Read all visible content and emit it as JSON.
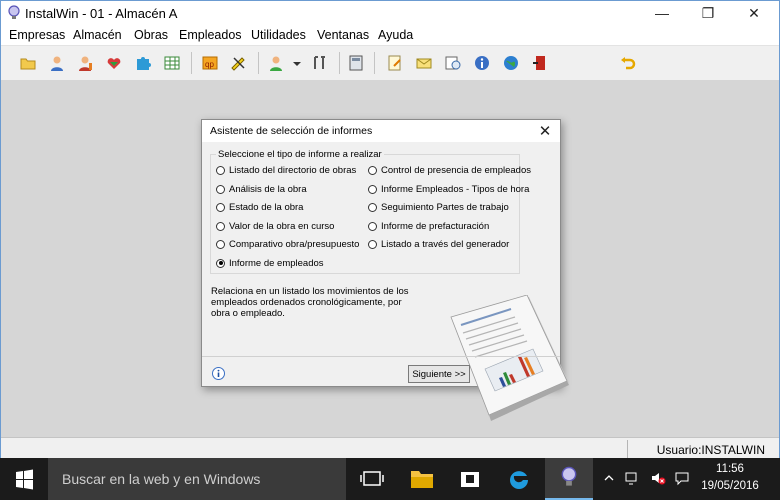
{
  "window": {
    "title": "InstalWin - 01 - Almacén A",
    "minimize": "—",
    "maximize": "❐",
    "close": "✕"
  },
  "menu": [
    "Empresas",
    "Almacén",
    "Obras",
    "Empleados",
    "Utilidades",
    "Ventanas",
    "Ayuda"
  ],
  "toolbar_icons": [
    "open-folder-icon",
    "user-icon",
    "user-edit-icon",
    "hearts-icon",
    "puzzle-icon",
    "table-icon",
    "qp-report-icon",
    "pencil-ruler-icon",
    "green-user-icon",
    "dropdown-arrow-icon",
    "tools-icon",
    "calculator-icon",
    "notepad-edit-icon",
    "envelope-icon",
    "clock-calendar-icon",
    "info-icon",
    "globe-icon",
    "exit-door-icon",
    "undo-arrow-icon"
  ],
  "statusbar": {
    "user": "Usuario:INSTALWIN"
  },
  "dialog": {
    "title": "Asistente de selección de informes",
    "close": "✕",
    "group_label": "Seleccione el tipo de informe a realizar",
    "options_left": [
      {
        "label": "Listado del directorio de obras",
        "selected": false
      },
      {
        "label": "Análisis de la obra",
        "selected": false
      },
      {
        "label": "Estado de la obra",
        "selected": false
      },
      {
        "label": "Valor de la obra en curso",
        "selected": false
      },
      {
        "label": "Comparativo obra/presupuesto",
        "selected": false
      },
      {
        "label": "Informe de empleados",
        "selected": true
      }
    ],
    "options_right": [
      {
        "label": "Control de presencia de empleados",
        "selected": false
      },
      {
        "label": "Informe Empleados - Tipos de hora",
        "selected": false
      },
      {
        "label": "Seguimiento Partes de trabajo",
        "selected": false
      },
      {
        "label": "Informe de prefacturación",
        "selected": false
      },
      {
        "label": "Listado a través del generador",
        "selected": false
      }
    ],
    "description": "Relaciona en un listado los movimientos de los empleados ordenados cronológicamente, por obra o empleado.",
    "next_button": "Siguiente >>"
  },
  "taskbar": {
    "search_placeholder": "Buscar en la web y en Windows",
    "time": "11:56",
    "date": "19/05/2016"
  }
}
